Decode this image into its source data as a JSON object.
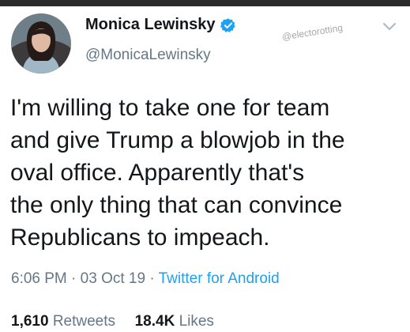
{
  "tweet": {
    "author": {
      "display_name": "Monica Lewinsky",
      "handle": "@MonicaLewinsky",
      "verified_icon": "verified-badge-icon"
    },
    "watermark": "@electorotting",
    "menu_icon": "chevron-down-icon",
    "text": "I'm willing to take one for team\nand give Trump a blowjob in the\noval office. Apparently that's\nthe only thing that can convince\nRepublicans to impeach.",
    "time": "6:06 PM",
    "separator": "·",
    "date": "03 Oct 19",
    "source": "Twitter for Android",
    "retweets_count": "1,610",
    "retweets_label": "Retweets",
    "likes_count": "18.4K",
    "likes_label": "Likes"
  },
  "colors": {
    "text": "#14171a",
    "secondary": "#657786",
    "link": "#1da1f2",
    "verified": "#1da1f2"
  }
}
